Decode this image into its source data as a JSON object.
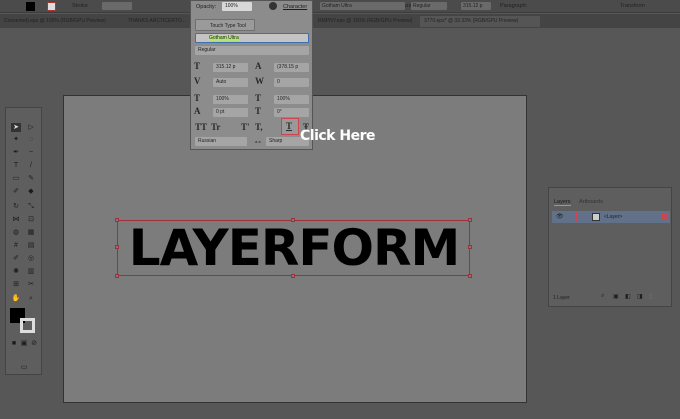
{
  "control_bar": {
    "stroke_label": "Stroke",
    "opacity_label": "Opacity:",
    "opacity_value": "100%",
    "character_label": "Character",
    "font": "Gotham Ultra",
    "style": "Regular",
    "size": "315.12 p",
    "paragraph_label": "Paragraph:",
    "transform_label": "Transform"
  },
  "tabs": [
    "Converted).eps @ 100% (RGB/GPU Preview)",
    "THANKS ARCTICERTO...",
    "RMPNY.eps @ 150% (RGB/GPU Preview)",
    "3770.eps* @ 33.33% (RGB/GPU Preview)"
  ],
  "character_panel": {
    "touch_type_label": "Touch Type Tool",
    "font_family": "Gotham Ultra",
    "font_style": "Regular",
    "font_size": "315.12 p",
    "leading": "(378.15 p",
    "kerning": "Auto",
    "tracking": "0",
    "vertical_scale": "100%",
    "horizontal_scale": "100%",
    "baseline_shift": "0 pt",
    "rotation": "0°",
    "language": "Russian",
    "aa_label": "a a",
    "antialiasing": "Sharp",
    "style_buttons": [
      "TT",
      "Tr",
      "T'",
      "T,",
      "T",
      "Ŧ"
    ]
  },
  "artboard": {
    "text": "LAYERFORM"
  },
  "annotation": "Click Here",
  "layers_panel": {
    "tabs": [
      "Layers",
      "Artboards"
    ],
    "layer_name": "<Layer>",
    "count": "1 Layer"
  },
  "colors": {
    "accent": "#d0454d",
    "highlight_green": "#b6e27a",
    "selection": "#a0303a"
  }
}
